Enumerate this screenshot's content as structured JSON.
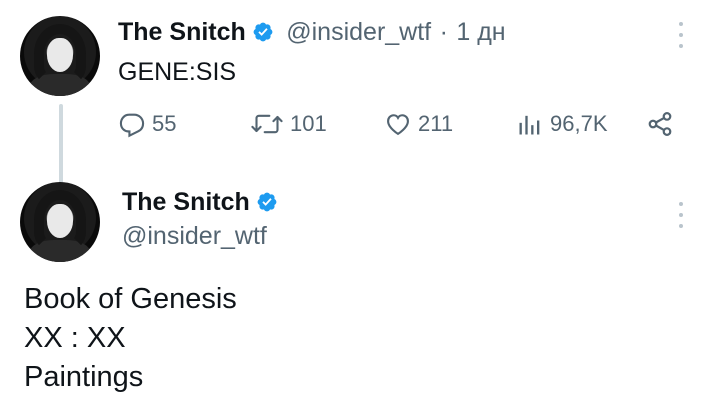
{
  "tweet1": {
    "author_name": "The Snitch",
    "handle": "@insider_wtf",
    "separator": "·",
    "time": "1 дн",
    "text": "GENE:SIS",
    "stats": {
      "replies": "55",
      "reposts": "101",
      "likes": "211",
      "views": "96,7K"
    }
  },
  "tweet2": {
    "author_name": "The Snitch",
    "handle": "@insider_wtf",
    "lines": [
      "Book of Genesis",
      "XX : XX",
      "Paintings"
    ]
  },
  "colors": {
    "verified": "#1d9bf0",
    "secondary_text": "#536471",
    "thread_line": "#cfd9de"
  },
  "icons": [
    "verified-badge-icon",
    "more-icon",
    "reply-icon",
    "repost-icon",
    "like-icon",
    "views-icon",
    "share-icon"
  ]
}
